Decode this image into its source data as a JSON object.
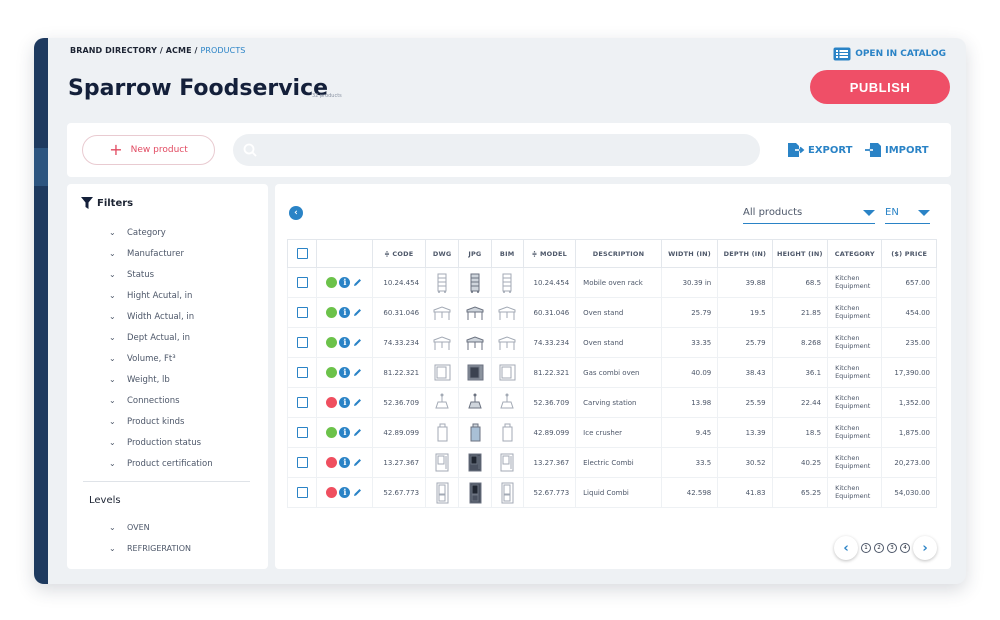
{
  "breadcrumb": {
    "part1": "BRAND DIRECTORY / ",
    "part2": "ACME / ",
    "current": "PRODUCTS"
  },
  "header": {
    "title": "Sparrow Foodservice",
    "count": "32 products",
    "open_catalog": "OPEN IN CATALOG",
    "publish": "PUBLISH"
  },
  "toolbar": {
    "new_product": "New product",
    "search_placeholder": "",
    "export": "EXPORT",
    "import": "IMPORT"
  },
  "filters": {
    "title": "Filters",
    "items": [
      "Category",
      "Manufacturer",
      "Status",
      "Hight Acutal, in",
      "Width Actual, in",
      "Dept Actual, in",
      "Volume, Ft³",
      "Weight, lb",
      "Connections",
      "Product kinds",
      "Production status",
      "Product certification"
    ],
    "levels_title": "Levels",
    "levels": [
      "OVEN",
      "REFRIGERATION"
    ]
  },
  "main": {
    "product_filter": "All products",
    "language": "EN"
  },
  "table": {
    "headers": {
      "code": "≑ CODE",
      "dwg": "DWG",
      "jpg": "JPG",
      "bim": "BIM",
      "model": "≑ MODEL",
      "description": "DESCRIPTION",
      "width": "WIDTH (IN)",
      "depth": "DEPTH (IN)",
      "height": "HEIGHT (IN)",
      "category": "CATEGORY",
      "price": "($) PRICE"
    },
    "rows": [
      {
        "status": "green",
        "code": "10.24.454",
        "model": "10.24.454",
        "description": "Mobile oven rack",
        "width": "30.39 in",
        "depth": "39.88",
        "height": "68.5",
        "category1": "Kitchen",
        "category2": "Equipment",
        "price": "657.00",
        "icon": "rack-icon"
      },
      {
        "status": "green",
        "code": "60.31.046",
        "model": "60.31.046",
        "description": "Oven stand",
        "width": "25.79",
        "depth": "19.5",
        "height": "21.85",
        "category1": "Kitchen",
        "category2": "Equipment",
        "price": "454.00",
        "icon": "stand-icon"
      },
      {
        "status": "green",
        "code": "74.33.234",
        "model": "74.33.234",
        "description": "Oven stand",
        "width": "33.35",
        "depth": "25.79",
        "height": "8.268",
        "category1": "Kitchen",
        "category2": "Equipment",
        "price": "235.00",
        "icon": "stand-icon"
      },
      {
        "status": "green",
        "code": "81.22.321",
        "model": "81.22.321",
        "description": "Gas combi oven",
        "width": "40.09",
        "depth": "38.43",
        "height": "36.1",
        "category1": "Kitchen",
        "category2": "Equipment",
        "price": "17,390.00",
        "icon": "oven-icon"
      },
      {
        "status": "red",
        "code": "52.36.709",
        "model": "52.36.709",
        "description": "Carving station",
        "width": "13.98",
        "depth": "25.59",
        "height": "22.44",
        "category1": "Kitchen",
        "category2": "Equipment",
        "price": "1,352.00",
        "icon": "carving-station-icon"
      },
      {
        "status": "green",
        "code": "42.89.099",
        "model": "42.89.099",
        "description": "Ice crusher",
        "width": "9.45",
        "depth": "13.39",
        "height": "18.5",
        "category1": "Kitchen",
        "category2": "Equipment",
        "price": "1,875.00",
        "icon": "ice-crusher-icon"
      },
      {
        "status": "red",
        "code": "13.27.367",
        "model": "13.27.367",
        "description": "Electric Combi",
        "width": "33.5",
        "depth": "30.52",
        "height": "40.25",
        "category1": "Kitchen",
        "category2": "Equipment",
        "price": "20,273.00",
        "icon": "combi-oven-icon"
      },
      {
        "status": "red",
        "code": "52.67.773",
        "model": "52.67.773",
        "description": "Liquid Combi",
        "width": "42.598",
        "depth": "41.83",
        "height": "65.25",
        "category1": "Kitchen",
        "category2": "Equipment",
        "price": "54,030.00",
        "icon": "tall-combi-icon"
      }
    ]
  },
  "pagination": {
    "pages": [
      "1",
      "2",
      "3",
      "4"
    ]
  },
  "colors": {
    "accent": "#2a83c6",
    "publish": "#ef4f67",
    "status_green": "#6cc24a",
    "status_red": "#ef4f5f",
    "navy": "#1e3a5f"
  }
}
